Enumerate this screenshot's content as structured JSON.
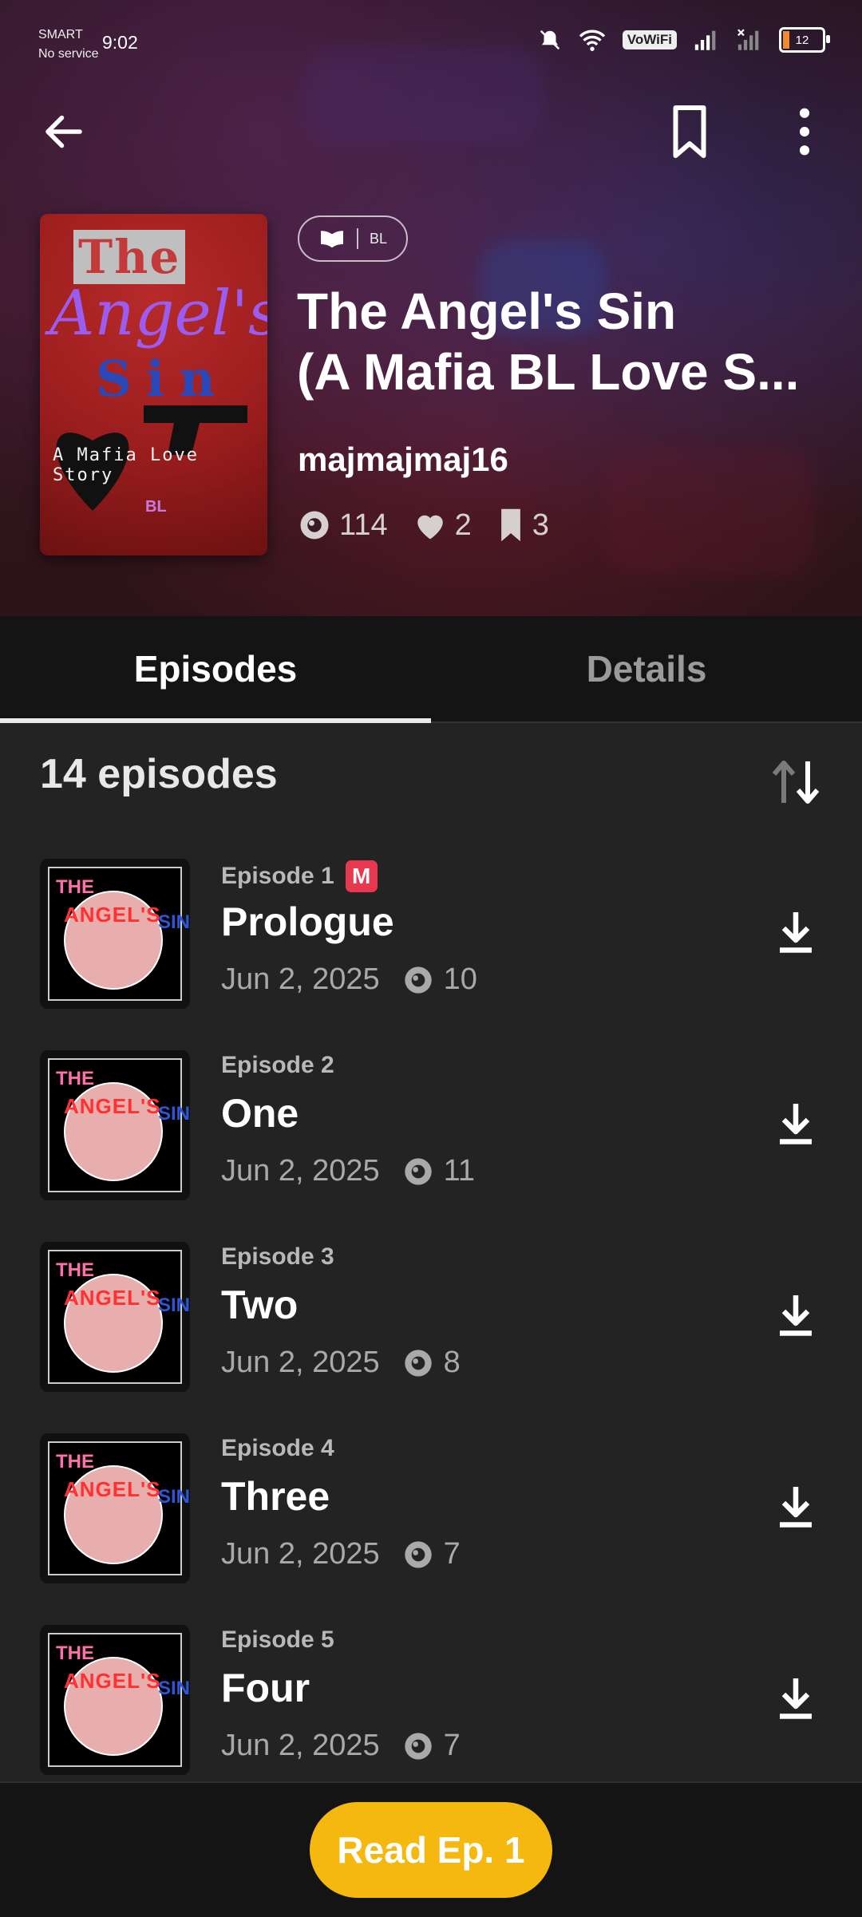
{
  "status_bar": {
    "carrier_line1": "SMART",
    "carrier_line2": "No service",
    "time": "9:02",
    "vowifi": "VoWiFi",
    "battery": "12"
  },
  "header": {
    "back_icon": "back-arrow-icon",
    "bookmark_icon": "bookmark-icon",
    "more_icon": "more-vertical-icon"
  },
  "story": {
    "cover": {
      "line1": "The",
      "line2": "Angel's",
      "line3": "Sin",
      "subtitle": "A Mafia Love Story",
      "tag": "BL"
    },
    "genre_label": "BL",
    "title_line1": "The Angel's Sin",
    "title_line2": "(A Mafia BL Love S...",
    "author": "majmajmaj16",
    "views": "114",
    "likes": "2",
    "bookmarks": "3"
  },
  "tabs": [
    {
      "label": "Episodes",
      "active": true
    },
    {
      "label": "Details",
      "active": false
    }
  ],
  "episodes_count_label": "14 episodes",
  "thumb_text": {
    "a": "THE",
    "b": "ANGEL'S",
    "c": "SIN"
  },
  "episodes": [
    {
      "number": "Episode 1",
      "badge": "M",
      "title": "Prologue",
      "date": "Jun 2, 2025",
      "views": "10"
    },
    {
      "number": "Episode 2",
      "badge": "",
      "title": "One",
      "date": "Jun 2, 2025",
      "views": "11"
    },
    {
      "number": "Episode 3",
      "badge": "",
      "title": "Two",
      "date": "Jun 2, 2025",
      "views": "8"
    },
    {
      "number": "Episode 4",
      "badge": "",
      "title": "Three",
      "date": "Jun 2, 2025",
      "views": "7"
    },
    {
      "number": "Episode 5",
      "badge": "",
      "title": "Four",
      "date": "Jun 2, 2025",
      "views": "7"
    }
  ],
  "read_button": "Read Ep. 1",
  "colors": {
    "accent": "#f5b80f",
    "badge": "#e8384f"
  }
}
